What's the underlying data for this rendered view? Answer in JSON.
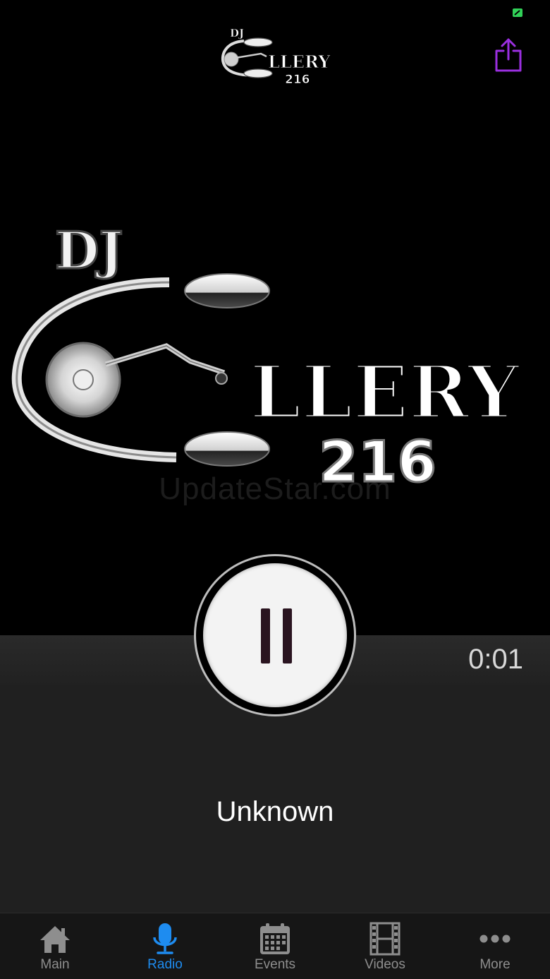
{
  "header": {
    "logo_text_top": "DJ",
    "logo_text_main": "LLERY",
    "logo_text_number": "216"
  },
  "hero": {
    "logo_text_top": "DJ",
    "logo_text_main": "LLERY",
    "logo_text_number": "216"
  },
  "watermark": "UpdateStar.com",
  "player": {
    "state": "playing",
    "elapsed": "0:01",
    "track_title": "Unknown"
  },
  "tabbar": {
    "active": "Radio",
    "tabs": [
      {
        "label": "Main",
        "icon": "home-icon"
      },
      {
        "label": "Radio",
        "icon": "microphone-icon"
      },
      {
        "label": "Events",
        "icon": "calendar-icon"
      },
      {
        "label": "Videos",
        "icon": "film-icon"
      },
      {
        "label": "More",
        "icon": "more-dots-icon"
      }
    ]
  },
  "colors": {
    "accent": "#1e8cf0",
    "share": "#9a2fe0",
    "status": "#31d158",
    "panel": "#202020"
  }
}
